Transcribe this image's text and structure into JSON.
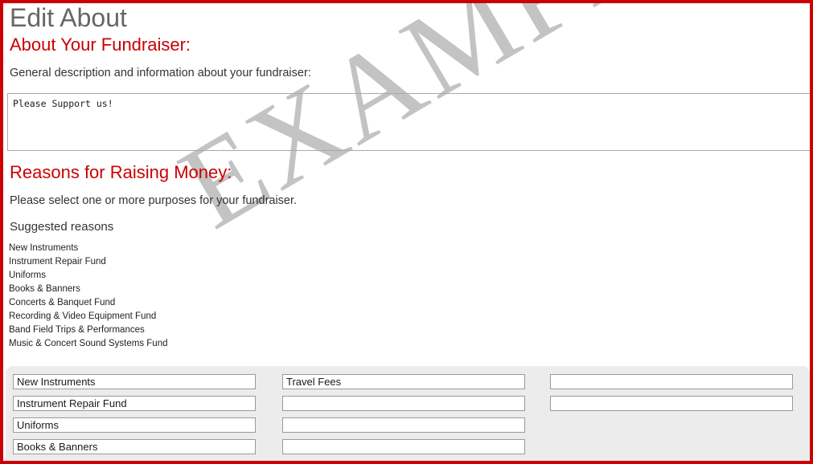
{
  "page": {
    "title": "Edit About",
    "watermark_text": "EXAMPLE",
    "watermark_color": "#c3c3c3",
    "accent_color": "#cc0000",
    "border_color": "#cc0000",
    "panel_color": "#ececec"
  },
  "about_section": {
    "heading": "About Your Fundraiser:",
    "description": "General description and information about your fundraiser:",
    "textarea_value": "Please Support us!",
    "textarea_placeholder": ""
  },
  "reasons_section": {
    "heading": "Reasons for Raising Money:",
    "description": "Please select one or more purposes for your fundraiser.",
    "suggested_label": "Suggested reasons",
    "suggested": [
      "New Instruments",
      "Instrument Repair Fund",
      "Uniforms",
      "Books & Banners",
      "Concerts & Banquet Fund",
      "Recording & Video Equipment Fund",
      "Band Field Trips & Performances",
      "Music & Concert Sound Systems Fund"
    ]
  },
  "reason_fields": {
    "column_1": [
      {
        "value": "New Instruments",
        "placeholder": ""
      },
      {
        "value": "Instrument Repair Fund",
        "placeholder": ""
      },
      {
        "value": "Uniforms",
        "placeholder": ""
      },
      {
        "value": "Books & Banners",
        "placeholder": ""
      }
    ],
    "column_2": [
      {
        "value": "Travel Fees",
        "placeholder": ""
      },
      {
        "value": "",
        "placeholder": ""
      },
      {
        "value": "",
        "placeholder": ""
      },
      {
        "value": "",
        "placeholder": ""
      }
    ],
    "column_3": [
      {
        "value": "",
        "placeholder": ""
      },
      {
        "value": "",
        "placeholder": ""
      }
    ]
  }
}
